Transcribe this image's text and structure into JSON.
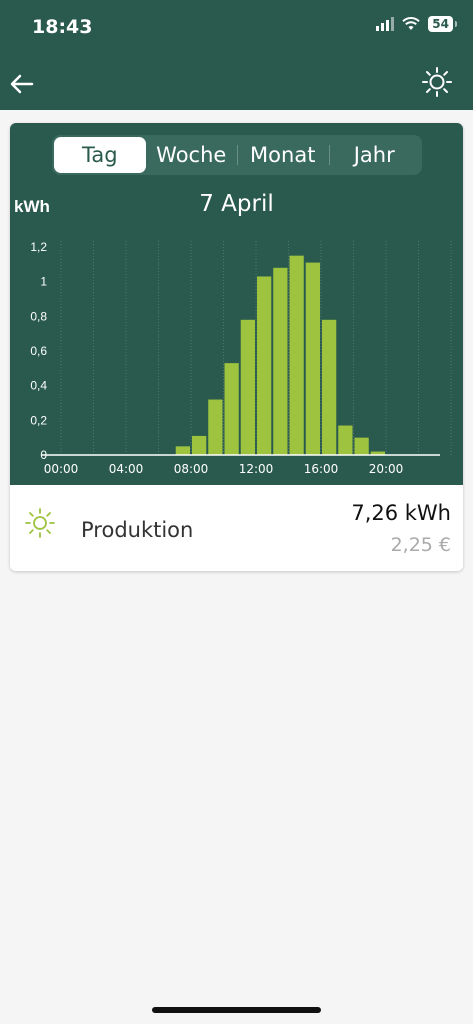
{
  "status_bar": {
    "time": "18:43",
    "battery": "54"
  },
  "header": {
    "back_icon": "arrow-left-icon",
    "action_icon": "sun-icon"
  },
  "tabs": [
    {
      "label": "Tag",
      "active": true
    },
    {
      "label": "Woche",
      "active": false
    },
    {
      "label": "Monat",
      "active": false
    },
    {
      "label": "Jahr",
      "active": false
    }
  ],
  "chart": {
    "unit": "kWh",
    "date": "7 April"
  },
  "chart_data": {
    "type": "bar",
    "ylabel": "kWh",
    "title": "7 April",
    "ylim": [
      0,
      1.2
    ],
    "yticks": [
      "0",
      "0,2",
      "0,4",
      "0,6",
      "0,8",
      "1",
      "1,2"
    ],
    "xticks": [
      "00:00",
      "04:00",
      "08:00",
      "12:00",
      "16:00",
      "20:00"
    ],
    "xlim_hours": [
      0,
      24
    ],
    "bar_color": "#9dc33f",
    "categories": [
      "07:00",
      "08:00",
      "09:00",
      "10:00",
      "11:00",
      "12:00",
      "13:00",
      "14:00",
      "15:00",
      "16:00",
      "17:00",
      "18:00",
      "19:00"
    ],
    "values": [
      0.05,
      0.11,
      0.32,
      0.53,
      0.78,
      1.03,
      1.08,
      1.15,
      1.11,
      0.78,
      0.17,
      0.1,
      0.02
    ]
  },
  "production": {
    "label": "Produktion",
    "value": "7,26 kWh",
    "price": "2,25 €",
    "icon": "sun-icon"
  },
  "colors": {
    "header": "#2a5a4d",
    "accent": "#9dc33f"
  }
}
